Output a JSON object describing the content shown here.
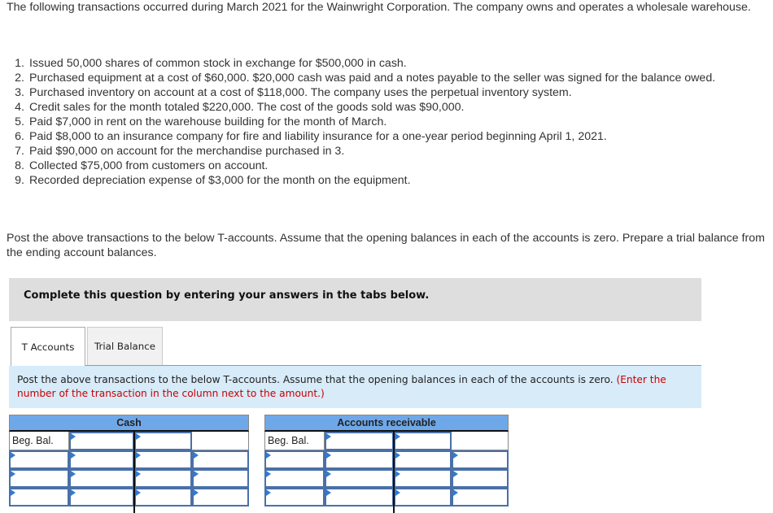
{
  "intro": "The following transactions occurred during March 2021 for the Wainwright Corporation. The company owns and operates a wholesale warehouse.",
  "transactions": [
    {
      "num": "1.",
      "text": "Issued 50,000 shares of common stock in exchange for $500,000 in cash."
    },
    {
      "num": "2.",
      "text": "Purchased equipment at a cost of $60,000. $20,000 cash was paid and a notes payable to the seller was signed for the balance owed."
    },
    {
      "num": "3.",
      "text": "Purchased inventory on account at a cost of $118,000. The company uses the perpetual inventory system."
    },
    {
      "num": "4.",
      "text": "Credit sales for the month totaled $220,000. The cost of the goods sold was $90,000."
    },
    {
      "num": "5.",
      "text": "Paid $7,000 in rent on the warehouse building for the month of March."
    },
    {
      "num": "6.",
      "text": "Paid $8,000 to an insurance company for fire and liability insurance for a one-year period beginning April 1, 2021."
    },
    {
      "num": "7.",
      "text": "Paid $90,000 on account for the merchandise purchased in 3."
    },
    {
      "num": "8.",
      "text": "Collected $75,000 from customers on account."
    },
    {
      "num": "9.",
      "text": "Recorded depreciation expense of $3,000 for the month on the equipment."
    }
  ],
  "post_instructions": "Post the above transactions to the below T-accounts. Assume that the opening balances in each of the accounts is zero. Prepare a trial balance from the ending account balances.",
  "instruction_banner": "Complete this question by entering your answers in the tabs below.",
  "tabs": [
    {
      "label": "T Accounts",
      "active": true
    },
    {
      "label": "Trial Balance",
      "active": false
    }
  ],
  "question": {
    "text": "Post the above transactions to the below T-accounts. Assume that the opening balances in each of the accounts is zero. ",
    "hint": "(Enter the number of the transaction in the column next to the amount.)"
  },
  "colors": {
    "header_blue": "#6fa8e8",
    "question_bg": "#d7ebf9",
    "hint_red": "#cc0000",
    "input_border": "#4a70a8"
  },
  "t_accounts": [
    {
      "title": "Cash",
      "beg_label": "Beg. Bal."
    },
    {
      "title": "Accounts receivable",
      "beg_label": "Beg. Bal."
    }
  ]
}
